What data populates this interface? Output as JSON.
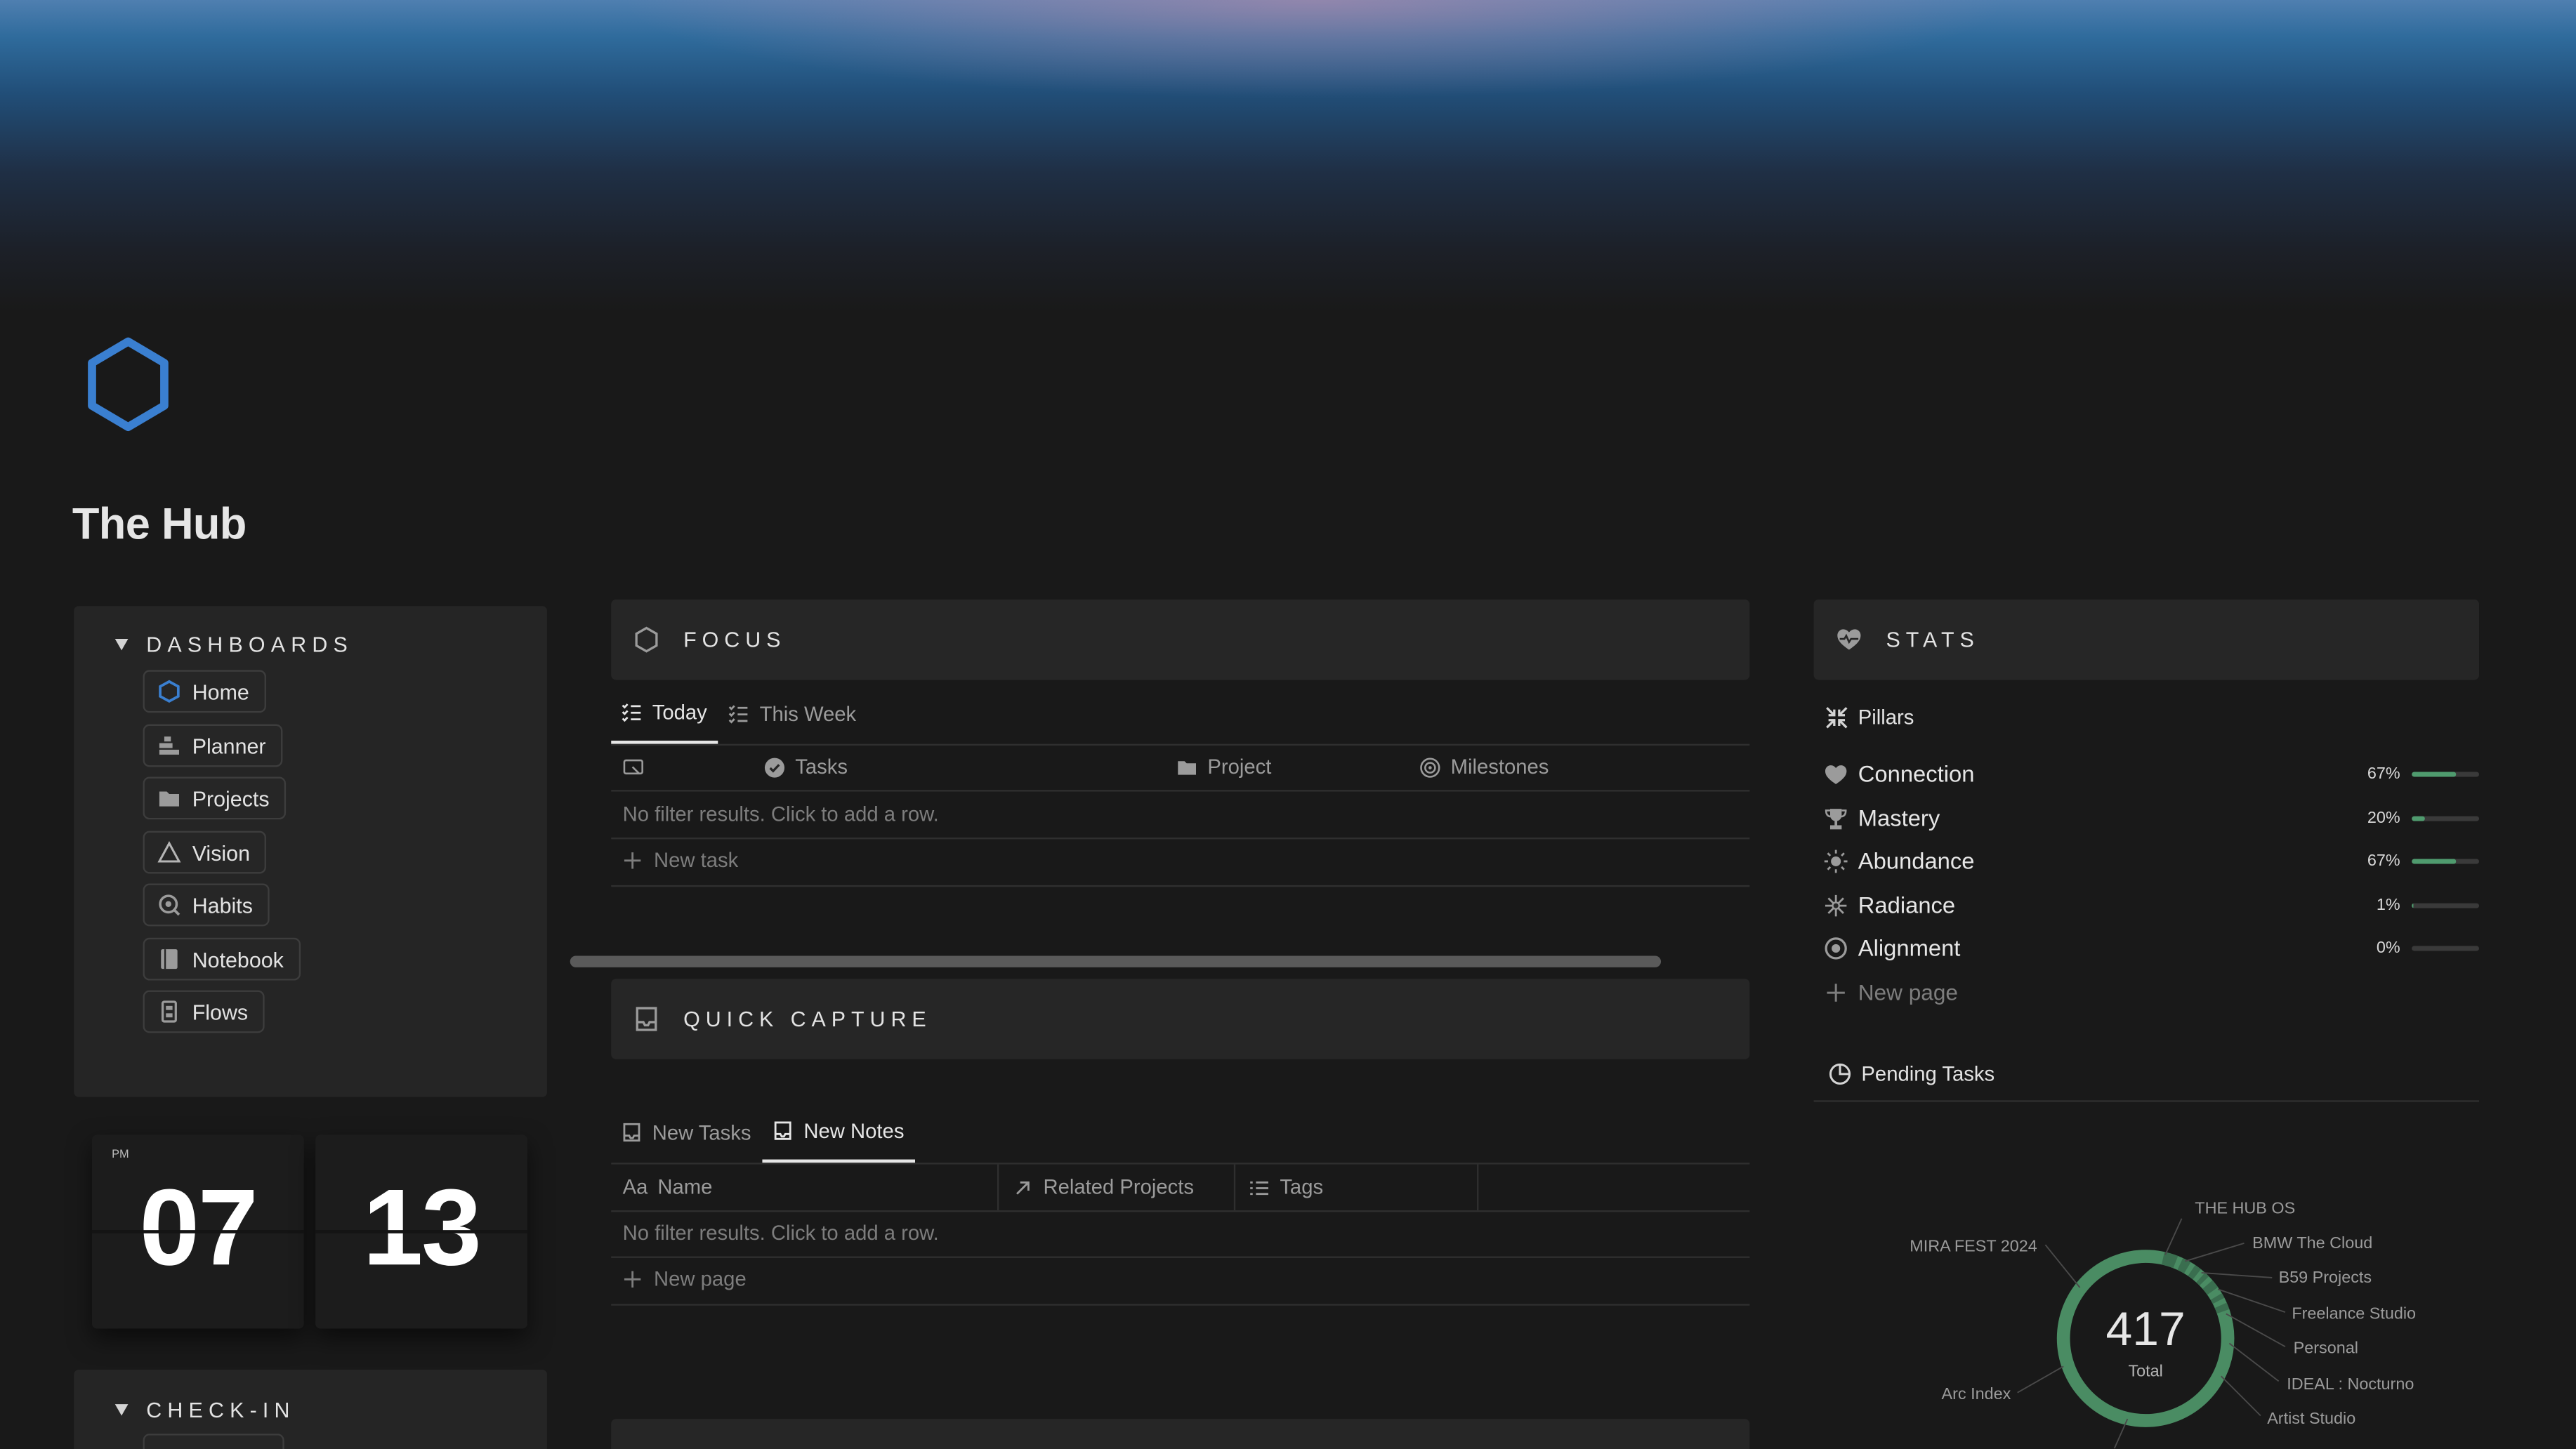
{
  "page": {
    "title": "The Hub"
  },
  "dashboards": {
    "heading": "DASHBOARDS",
    "items": [
      {
        "label": "Home",
        "icon": "hexagon-icon"
      },
      {
        "label": "Planner",
        "icon": "planner-icon"
      },
      {
        "label": "Projects",
        "icon": "folder-icon"
      },
      {
        "label": "Vision",
        "icon": "triangle-icon"
      },
      {
        "label": "Habits",
        "icon": "habits-icon"
      },
      {
        "label": "Notebook",
        "icon": "notebook-icon"
      },
      {
        "label": "Flows",
        "icon": "flows-icon"
      }
    ]
  },
  "clock": {
    "ampm": "PM",
    "hour": "07",
    "minute": "13"
  },
  "checkin": {
    "heading": "CHECK-IN"
  },
  "focus": {
    "heading": "FOCUS",
    "tabs": [
      "Today",
      "This Week"
    ],
    "columns": [
      "Tasks",
      "Project",
      "Milestones"
    ],
    "empty_text": "No filter results. Click to add a row.",
    "add_label": "New task"
  },
  "quick_capture": {
    "heading": "QUICK CAPTURE",
    "tabs": [
      "New Tasks",
      "New Notes"
    ],
    "columns": [
      "Name",
      "Related Projects",
      "Tags"
    ],
    "name_prefix": "Aa",
    "empty_text": "No filter results. Click to add a row.",
    "add_label": "New page"
  },
  "stats": {
    "heading": "STATS",
    "pillars_label": "Pillars",
    "pillars": [
      {
        "name": "Connection",
        "percent": "67%",
        "fraction": 0.67,
        "icon": "heart-icon"
      },
      {
        "name": "Mastery",
        "percent": "20%",
        "fraction": 0.2,
        "icon": "trophy-icon"
      },
      {
        "name": "Abundance",
        "percent": "67%",
        "fraction": 0.67,
        "icon": "sun-icon"
      },
      {
        "name": "Radiance",
        "percent": "1%",
        "fraction": 0.01,
        "icon": "sparkle-icon"
      },
      {
        "name": "Alignment",
        "percent": "0%",
        "fraction": 0.0,
        "icon": "target-icon"
      }
    ],
    "add_label": "New page",
    "pending_label": "Pending Tasks"
  },
  "chart_data": {
    "type": "pie",
    "center_value": "417",
    "center_label": "Total",
    "categories": [
      "THE HUB OS",
      "BMW The Cloud",
      "B59 Projects",
      "Freelance Studio",
      "Personal",
      "IDEAL : Nocturno",
      "Artist Studio",
      "Arc Index",
      "MIRA FEST 2024"
    ],
    "ring_color": "#4a8c63"
  }
}
